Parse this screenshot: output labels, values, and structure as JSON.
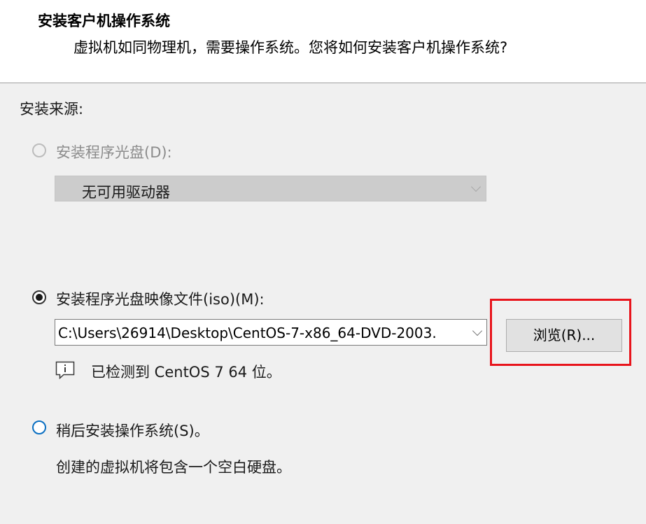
{
  "header": {
    "title": "安装客户机操作系统",
    "subtitle": "虚拟机如同物理机，需要操作系统。您将如何安装客户机操作系统?"
  },
  "install_source": {
    "label": "安装来源:",
    "disc_option": {
      "label": "安装程序光盘(D):",
      "enabled": false,
      "selected": false,
      "drive_value": "无可用驱动器"
    },
    "iso_option": {
      "label": "安装程序光盘映像文件(iso)(M):",
      "selected": true,
      "path_value": "C:\\Users\\26914\\Desktop\\CentOS-7-x86_64-DVD-2003.",
      "browse_label": "浏览(R)...",
      "detected_message": "已检测到 CentOS 7 64 位。"
    },
    "later_option": {
      "label": "稍后安装操作系统(S)。",
      "selected": false,
      "description": "创建的虚拟机将包含一个空白硬盘。"
    }
  },
  "colors": {
    "highlight": "#e8141c",
    "focus_blue": "#0a6fc2",
    "panel_bg": "#f0f0f0"
  },
  "icons": {
    "info": "info-speech-bubble-icon",
    "dropdown": "chevron-down-icon"
  }
}
